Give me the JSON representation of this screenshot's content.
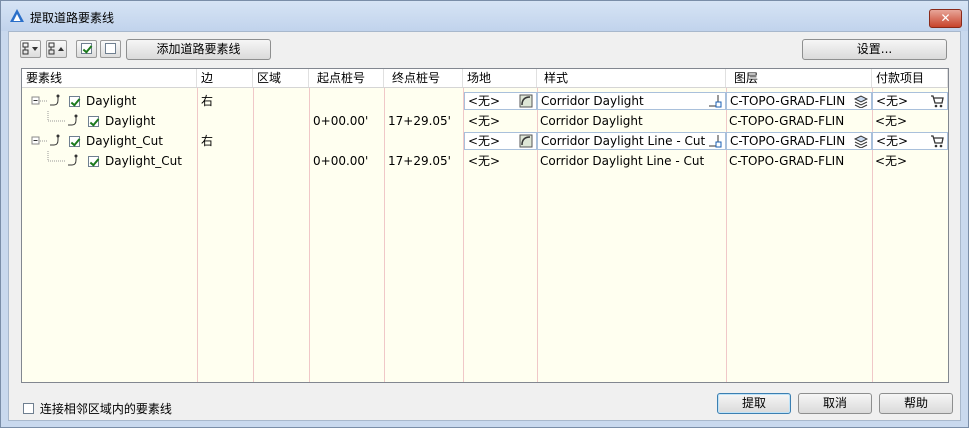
{
  "window": {
    "title": "提取道路要素线",
    "close_glyph": "✕"
  },
  "toolbar": {
    "add_button": "添加道路要素线",
    "settings_button": "设置..."
  },
  "table": {
    "headers": [
      "要素线",
      "边",
      "区域",
      "起点桩号",
      "终点桩号",
      "场地",
      "样式",
      "图层",
      "付款项目"
    ],
    "rows": [
      {
        "name": "Daylight",
        "side": "右",
        "region": "",
        "start": "",
        "end": "",
        "site": "<无>",
        "style": "Corridor Daylight",
        "layer": "C-TOPO-GRAD-FLIN",
        "pay": "<无>"
      },
      {
        "name": "Daylight",
        "side": "",
        "region": "",
        "start": "0+00.00'",
        "end": "17+29.05'",
        "site": "<无>",
        "style": "Corridor Daylight",
        "layer": "C-TOPO-GRAD-FLIN",
        "pay": "<无>"
      },
      {
        "name": "Daylight_Cut",
        "side": "右",
        "region": "",
        "start": "",
        "end": "",
        "site": "<无>",
        "style": "Corridor Daylight Line - Cut",
        "layer": "C-TOPO-GRAD-FLIN",
        "pay": "<无>"
      },
      {
        "name": "Daylight_Cut",
        "side": "",
        "region": "",
        "start": "0+00.00'",
        "end": "17+29.05'",
        "site": "<无>",
        "style": "Corridor Daylight Line - Cut",
        "layer": "C-TOPO-GRAD-FLIN",
        "pay": "<无>"
      }
    ]
  },
  "footer": {
    "connect_label": "连接相邻区域内的要素线",
    "extract_button": "提取",
    "cancel_button": "取消",
    "help_button": "帮助"
  }
}
